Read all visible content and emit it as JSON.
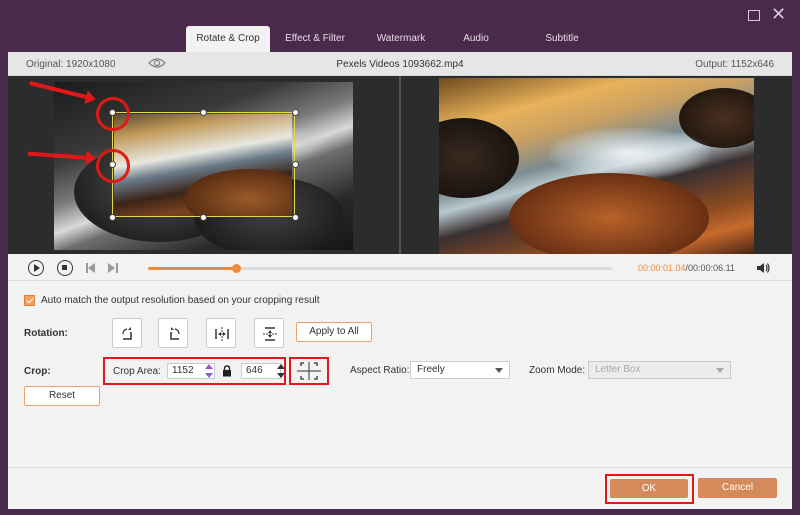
{
  "tabs": [
    "Rotate & Crop",
    "Effect & Filter",
    "Watermark",
    "Audio",
    "Subtitle"
  ],
  "info": {
    "original": "Original: 1920x1080",
    "filename": "Pexels Videos 1093662.mp4",
    "output": "Output: 1152x646"
  },
  "playback": {
    "current_time": "00:00:01.04",
    "total_time": "/00:00:06.11",
    "progress": 0.19
  },
  "auto_match": {
    "label": "Auto match the output resolution based on your cropping result",
    "checked": true
  },
  "rotation": {
    "label": "Rotation:",
    "apply_all": "Apply to All"
  },
  "crop": {
    "label": "Crop:",
    "area_label": "Crop Area:",
    "width": "1152",
    "height": "646",
    "aspect_label": "Aspect Ratio:",
    "aspect_value": "Freely",
    "zoom_label": "Zoom Mode:",
    "zoom_value": "Letter Box",
    "reset": "Reset"
  },
  "footer": {
    "ok": "OK",
    "cancel": "Cancel"
  },
  "colors": {
    "accent": "#f08a3a",
    "button": "#d48a5a",
    "highlight": "#e01818",
    "titlebar": "#4a2a4a"
  }
}
